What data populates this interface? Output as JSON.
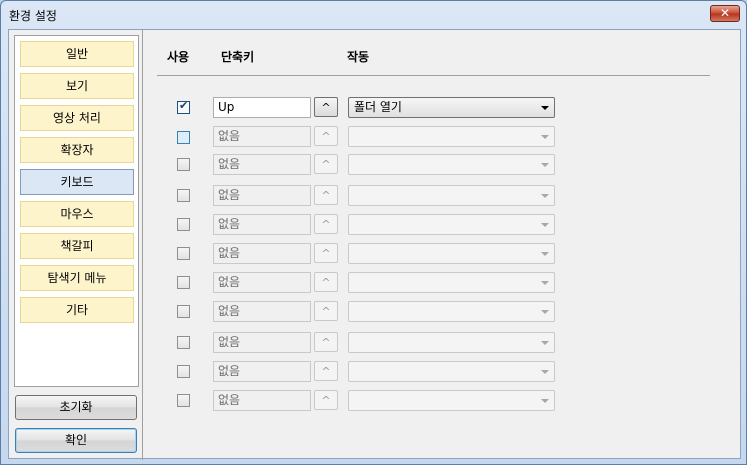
{
  "window": {
    "title": "환경 설정",
    "close_glyph": "✕"
  },
  "sidebar": {
    "items": [
      {
        "label": "일반"
      },
      {
        "label": "보기"
      },
      {
        "label": "영상 처리"
      },
      {
        "label": "확장자"
      },
      {
        "label": "키보드"
      },
      {
        "label": "마우스"
      },
      {
        "label": "책갈피"
      },
      {
        "label": "탐색기 메뉴"
      },
      {
        "label": "기타"
      }
    ],
    "active_item": "키보드",
    "reset_label": "초기화",
    "ok_label": "확인"
  },
  "table": {
    "headers": {
      "use": "사용",
      "shortcut": "단축키",
      "action": "작동"
    },
    "modifier_glyph": "^",
    "check_glyph": "✔",
    "rows": [
      {
        "checked": true,
        "key": "Up",
        "action": "폴더 열기",
        "enabled": true
      },
      {
        "checked": false,
        "key": "없음",
        "action": "",
        "enabled": false
      },
      {
        "checked": false,
        "key": "없음",
        "action": "",
        "enabled": false
      },
      {
        "checked": false,
        "key": "없음",
        "action": "",
        "enabled": false
      },
      {
        "checked": false,
        "key": "없음",
        "action": "",
        "enabled": false
      },
      {
        "checked": false,
        "key": "없음",
        "action": "",
        "enabled": false
      },
      {
        "checked": false,
        "key": "없음",
        "action": "",
        "enabled": false
      },
      {
        "checked": false,
        "key": "없음",
        "action": "",
        "enabled": false
      },
      {
        "checked": false,
        "key": "없음",
        "action": "",
        "enabled": false
      },
      {
        "checked": false,
        "key": "없음",
        "action": "",
        "enabled": false
      },
      {
        "checked": false,
        "key": "없음",
        "action": "",
        "enabled": false
      }
    ]
  }
}
